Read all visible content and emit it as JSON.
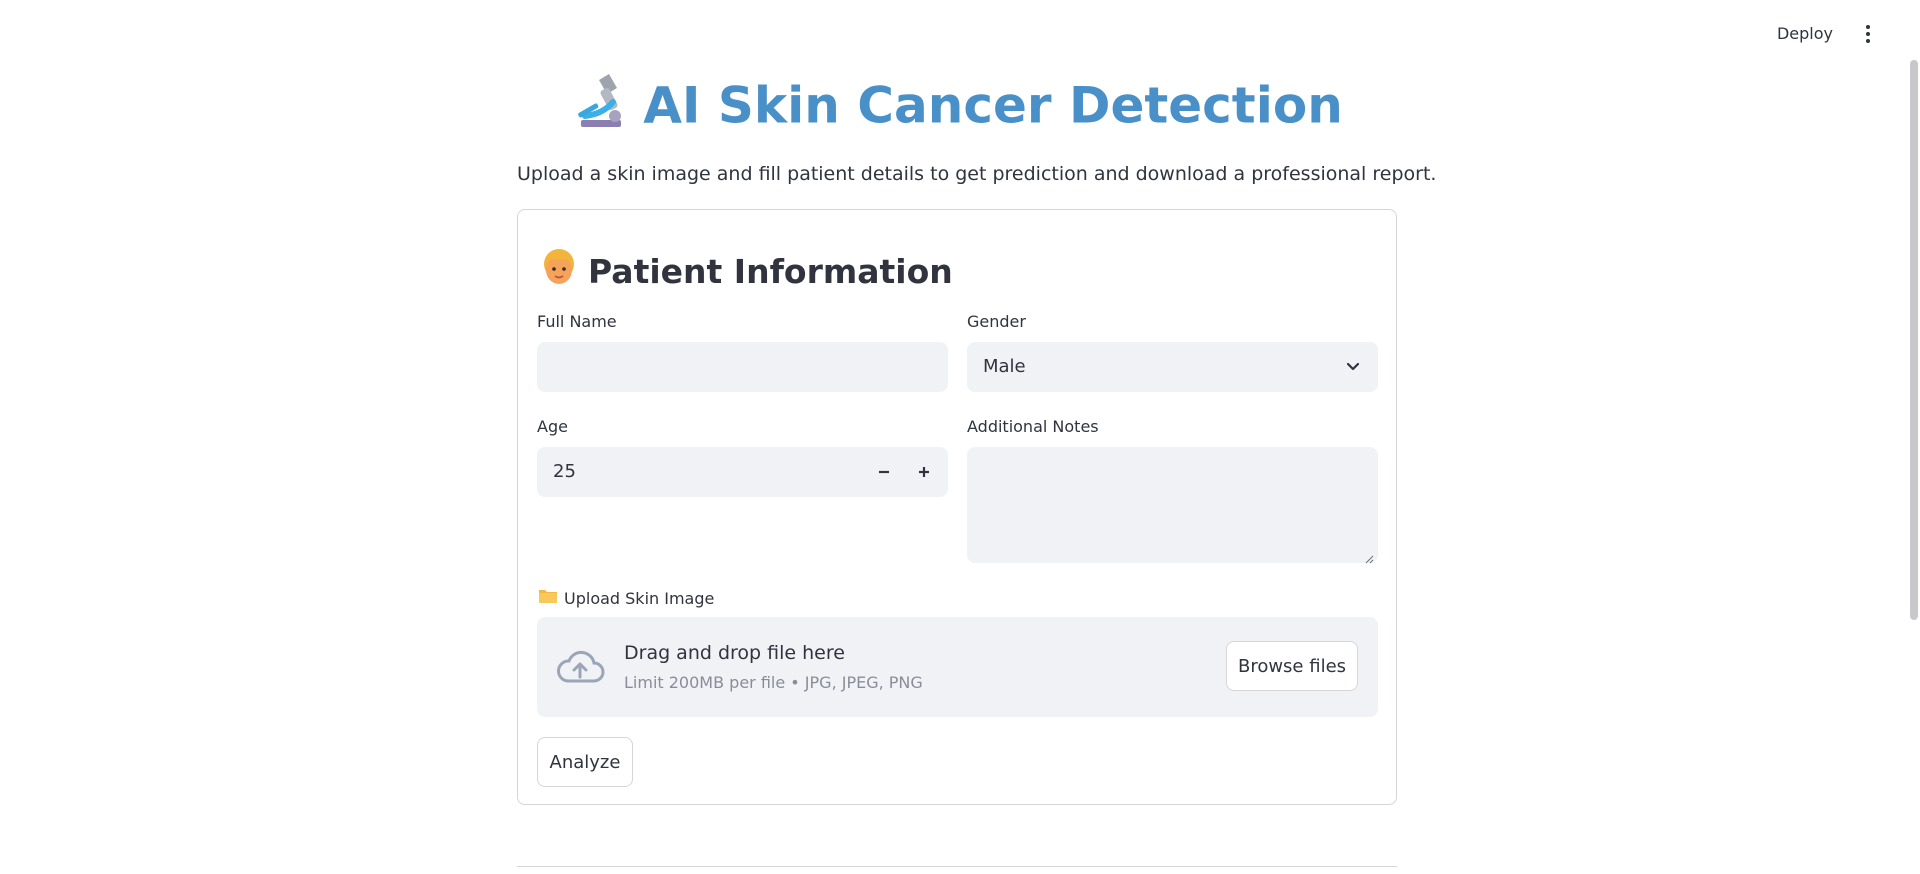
{
  "header": {
    "deploy_label": "Deploy",
    "menu_icon": "kebab-menu-icon"
  },
  "page": {
    "title": "AI Skin Cancer Detection",
    "title_icon": "microscope-icon",
    "subtitle": "Upload a skin image and fill patient details to get prediction and download a professional report.",
    "title_color": "#4a90c8"
  },
  "form": {
    "section_title": "Patient Information",
    "section_icon": "person-face-icon",
    "full_name": {
      "label": "Full Name",
      "value": ""
    },
    "gender": {
      "label": "Gender",
      "value": "Male"
    },
    "age": {
      "label": "Age",
      "value": "25"
    },
    "notes": {
      "label": "Additional Notes",
      "value": ""
    },
    "upload": {
      "label": "Upload Skin Image",
      "label_icon": "folder-icon",
      "drop_text": "Drag and drop file here",
      "limit_text": "Limit 200MB per file • JPG, JPEG, PNG",
      "browse_label": "Browse files"
    },
    "analyze_label": "Analyze"
  }
}
